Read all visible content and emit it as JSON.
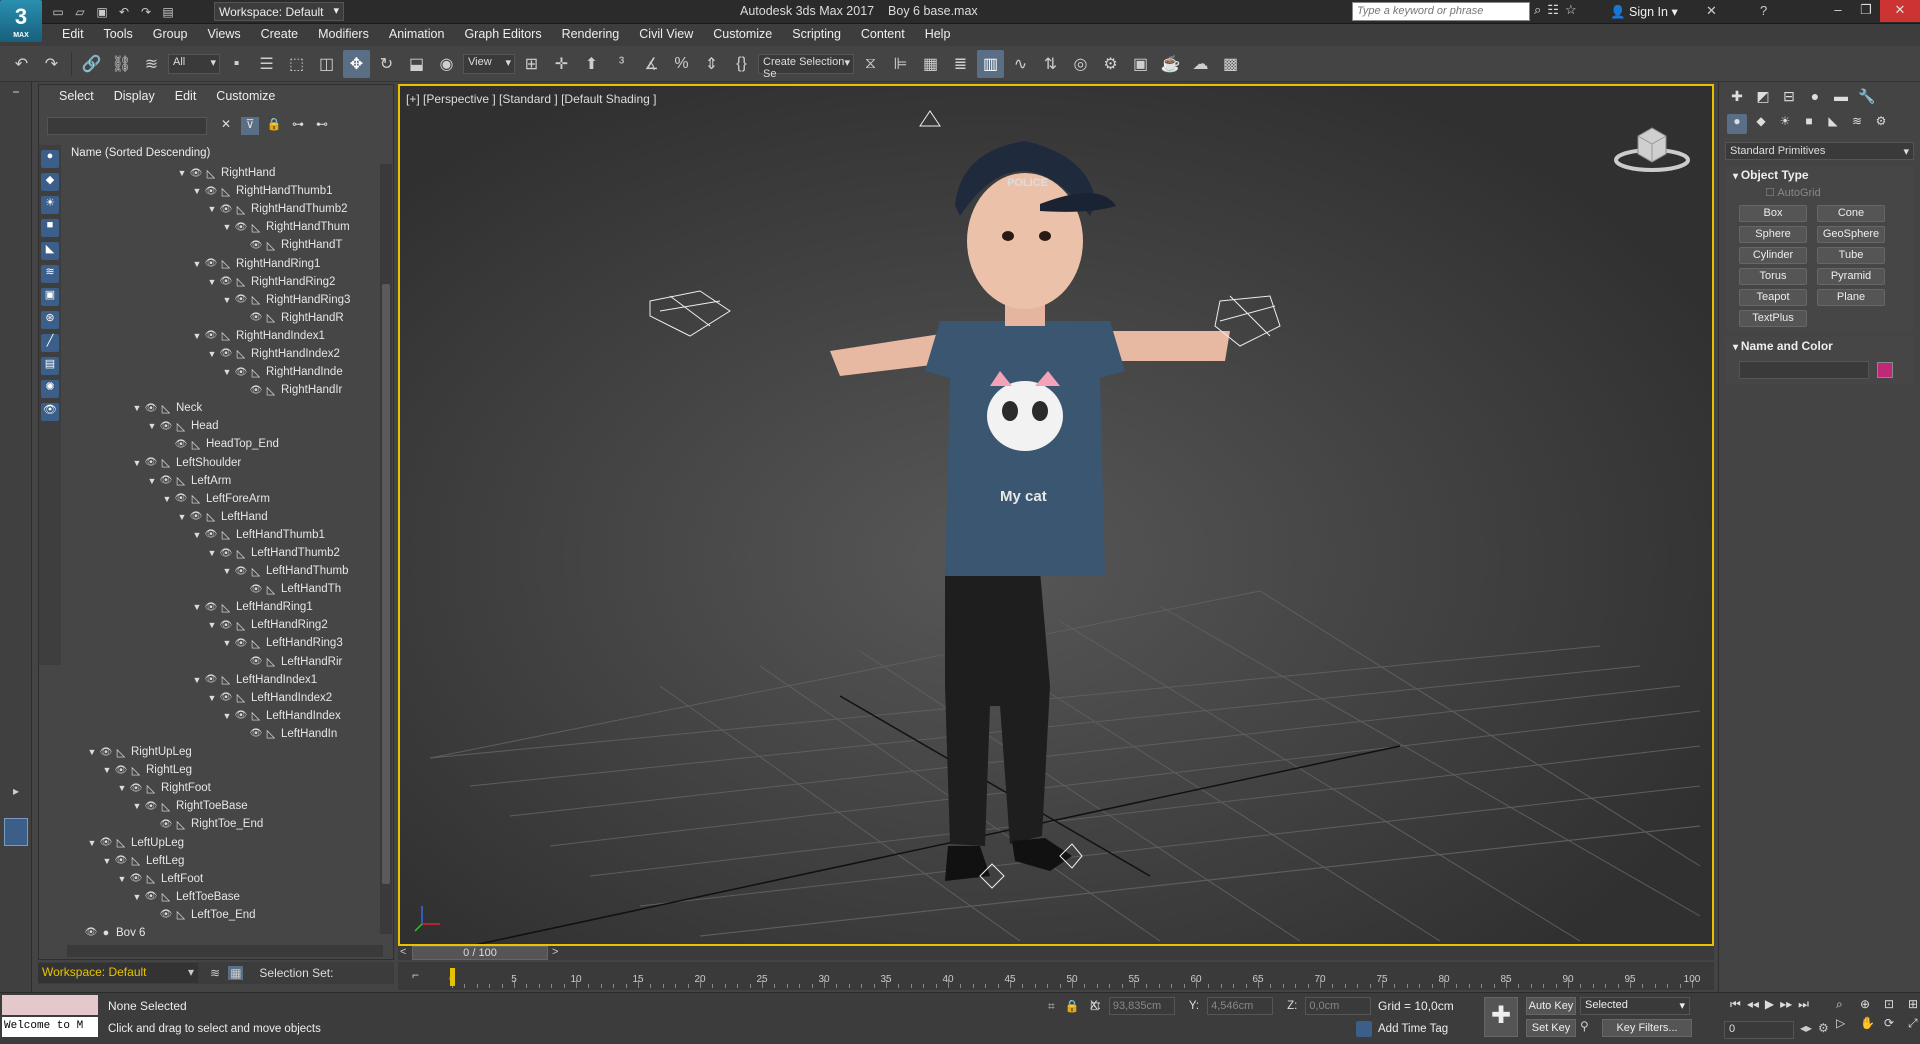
{
  "title": {
    "app": "Autodesk 3ds Max 2017",
    "file": "Boy 6 base.max",
    "workspace": "Workspace: Default",
    "keyword_placeholder": "Type a keyword or phrase",
    "sign_in": "Sign In",
    "logo_text": "3",
    "logo_sub": "MAX"
  },
  "menu": [
    "Edit",
    "Tools",
    "Group",
    "Views",
    "Create",
    "Modifiers",
    "Animation",
    "Graph Editors",
    "Rendering",
    "Civil View",
    "Customize",
    "Scripting",
    "Content",
    "Help"
  ],
  "toolbar": {
    "filter": "All",
    "refcoord": "View",
    "named_sel": "Create Selection Se"
  },
  "explorer": {
    "menu": [
      "Select",
      "Display",
      "Edit",
      "Customize"
    ],
    "column_header": "Name (Sorted Descending)",
    "tree": [
      {
        "name": "RightHand",
        "level": 7
      },
      {
        "name": "RightHandThumb1",
        "level": 8
      },
      {
        "name": "RightHandThumb2",
        "level": 9
      },
      {
        "name": "RightHandThum",
        "level": 10
      },
      {
        "name": "RightHandT",
        "level": 11
      },
      {
        "name": "RightHandRing1",
        "level": 8
      },
      {
        "name": "RightHandRing2",
        "level": 9
      },
      {
        "name": "RightHandRing3",
        "level": 10
      },
      {
        "name": "RightHandR",
        "level": 11
      },
      {
        "name": "RightHandIndex1",
        "level": 8
      },
      {
        "name": "RightHandIndex2",
        "level": 9
      },
      {
        "name": "RightHandInde",
        "level": 10
      },
      {
        "name": "RightHandIr",
        "level": 11
      },
      {
        "name": "Neck",
        "level": 4
      },
      {
        "name": "Head",
        "level": 5
      },
      {
        "name": "HeadTop_End",
        "level": 6
      },
      {
        "name": "LeftShoulder",
        "level": 4
      },
      {
        "name": "LeftArm",
        "level": 5
      },
      {
        "name": "LeftForeArm",
        "level": 6
      },
      {
        "name": "LeftHand",
        "level": 7
      },
      {
        "name": "LeftHandThumb1",
        "level": 8
      },
      {
        "name": "LeftHandThumb2",
        "level": 9
      },
      {
        "name": "LeftHandThumb",
        "level": 10
      },
      {
        "name": "LeftHandTh",
        "level": 11
      },
      {
        "name": "LeftHandRing1",
        "level": 8
      },
      {
        "name": "LeftHandRing2",
        "level": 9
      },
      {
        "name": "LeftHandRing3",
        "level": 10
      },
      {
        "name": "LeftHandRir",
        "level": 11
      },
      {
        "name": "LeftHandIndex1",
        "level": 8
      },
      {
        "name": "LeftHandIndex2",
        "level": 9
      },
      {
        "name": "LeftHandIndex",
        "level": 10
      },
      {
        "name": "LeftHandIn",
        "level": 11
      },
      {
        "name": "RightUpLeg",
        "level": 1
      },
      {
        "name": "RightLeg",
        "level": 2
      },
      {
        "name": "RightFoot",
        "level": 3
      },
      {
        "name": "RightToeBase",
        "level": 4
      },
      {
        "name": "RightToe_End",
        "level": 5
      },
      {
        "name": "LeftUpLeg",
        "level": 1
      },
      {
        "name": "LeftLeg",
        "level": 2
      },
      {
        "name": "LeftFoot",
        "level": 3
      },
      {
        "name": "LeftToeBase",
        "level": 4
      },
      {
        "name": "LeftToe_End",
        "level": 5
      },
      {
        "name": "Boy 6",
        "level": 0
      }
    ],
    "workspace": "Workspace: Default",
    "selection_set": "Selection Set:"
  },
  "viewport": {
    "label": "[+] [Perspective ] [Standard ] [Default Shading ]",
    "cap_text": "POLICE",
    "shirt_text": "My cat"
  },
  "timeline": {
    "slider": "0 / 100",
    "ticks": [
      0,
      5,
      10,
      15,
      20,
      25,
      30,
      35,
      40,
      45,
      50,
      55,
      60,
      65,
      70,
      75,
      80,
      85,
      90,
      95,
      100
    ]
  },
  "command_panel": {
    "primitive_type": "Standard Primitives",
    "object_type_title": "Object Type",
    "autogrid": "AutoGrid",
    "buttons": [
      "Box",
      "Cone",
      "Sphere",
      "GeoSphere",
      "Cylinder",
      "Tube",
      "Torus",
      "Pyramid",
      "Teapot",
      "Plane",
      "TextPlus"
    ],
    "name_color_title": "Name and Color",
    "swatch_color": "#c0287a"
  },
  "status": {
    "maxscript": "Welcome to M",
    "selection": "None Selected",
    "prompt": "Click and drag to select and move objects",
    "x_label": "X:",
    "x_value": "93,835cm",
    "y_label": "Y:",
    "y_value": "4,546cm",
    "z_label": "Z:",
    "z_value": "0,0cm",
    "grid": "Grid = 10,0cm",
    "add_time_tag": "Add Time Tag",
    "auto_key": "Auto Key",
    "set_key": "Set Key",
    "selected": "Selected",
    "key_filters": "Key Filters...",
    "frame": "0"
  },
  "colors": {
    "accent": "#e6c200",
    "selection": "#5a6f85"
  }
}
